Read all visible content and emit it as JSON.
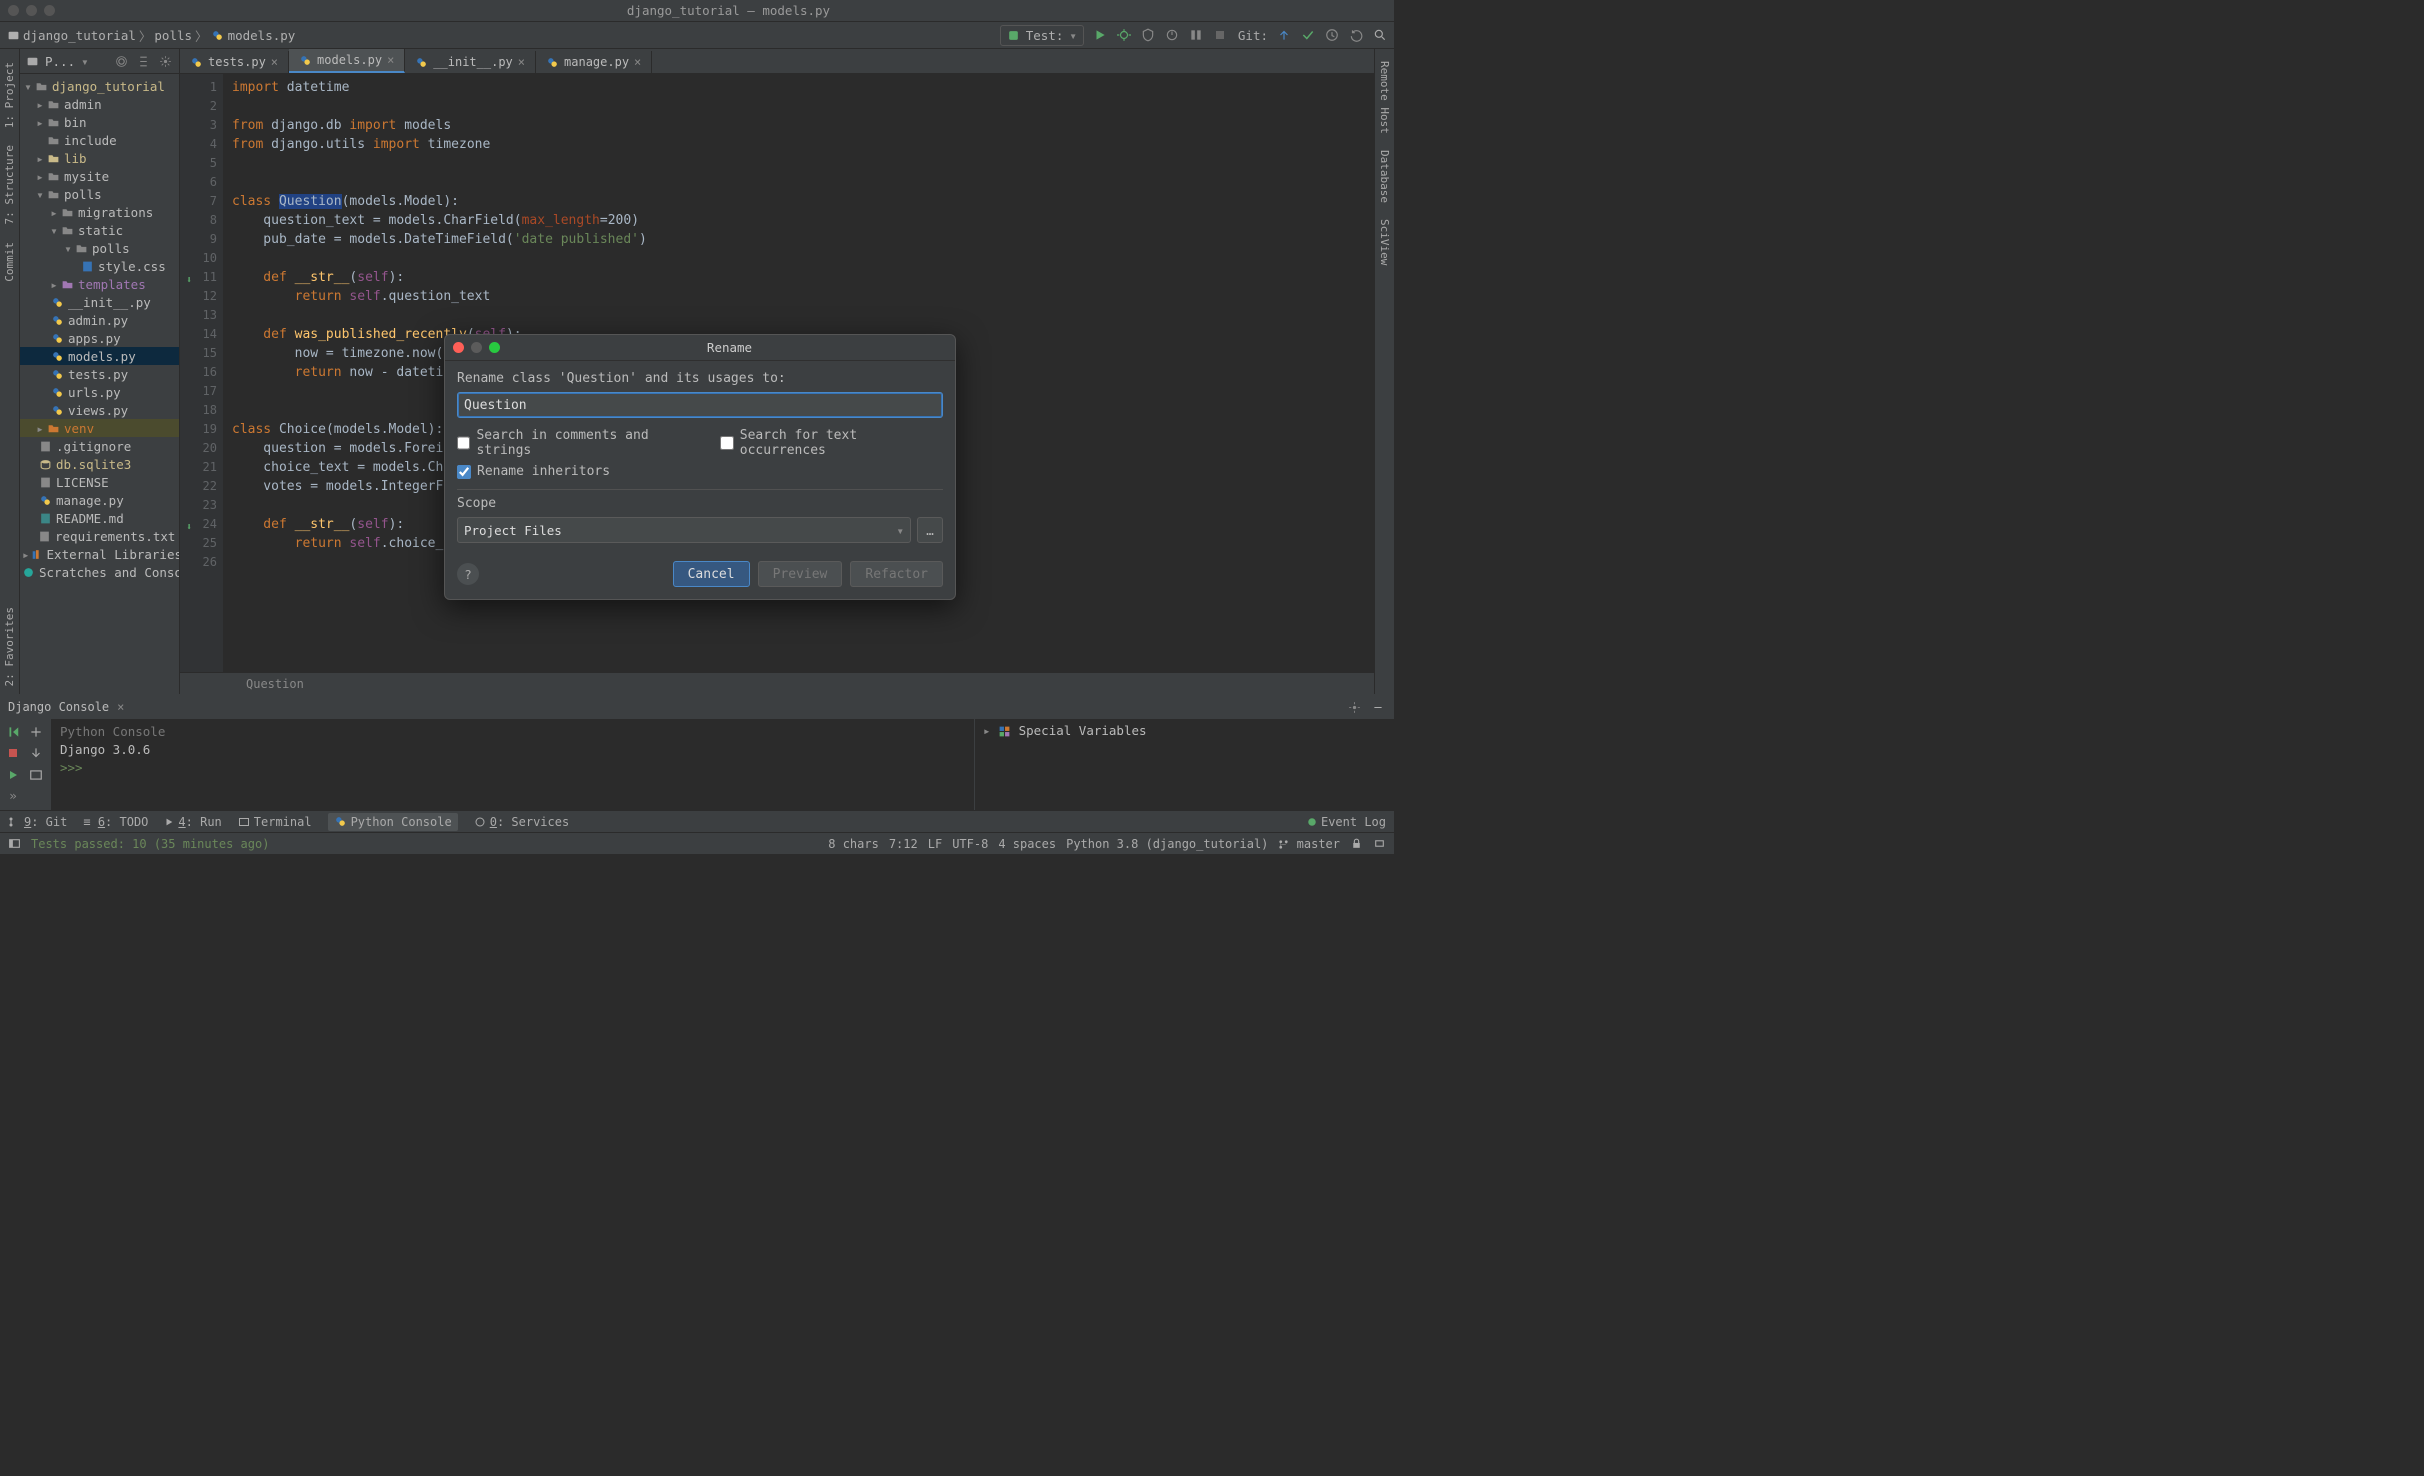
{
  "window_title": "django_tutorial – models.py",
  "breadcrumbs": {
    "p1": "django_tutorial",
    "p2": "polls",
    "p3": "models.py"
  },
  "run_config": "Test:",
  "git_label": "Git:",
  "left_tabs": {
    "project": "1: Project",
    "structure": "7: Structure",
    "commit": "Commit",
    "favorites": "2: Favorites"
  },
  "right_tabs": {
    "remote": "Remote Host",
    "database": "Database",
    "sciview": "SciView"
  },
  "project_header": "P...",
  "tree": {
    "root": "django_tutorial",
    "admin": "admin",
    "bin": "bin",
    "include": "include",
    "lib": "lib",
    "mysite": "mysite",
    "polls": "polls",
    "migrations": "migrations",
    "static": "static",
    "pollsdir": "polls",
    "stylecss": "style.css",
    "templates": "templates",
    "initpy": "__init__.py",
    "adminpy": "admin.py",
    "appspy": "apps.py",
    "modelspy": "models.py",
    "testspy": "tests.py",
    "urlspy": "urls.py",
    "viewspy": "views.py",
    "venv": "venv",
    "gitignore": ".gitignore",
    "dbsqlite": "db.sqlite3",
    "license": "LICENSE",
    "managepy": "manage.py",
    "readme": "README.md",
    "requirements": "requirements.txt",
    "extlib": "External Libraries",
    "scratches": "Scratches and Consoles"
  },
  "tabs": {
    "t1": "tests.py",
    "t2": "models.py",
    "t3": "__init__.py",
    "t4": "manage.py"
  },
  "code": {
    "l1a": "import",
    "l1b": " datetime",
    "l3a": "from",
    "l3b": " django.db ",
    "l3c": "import",
    "l3d": " models",
    "l4a": "from",
    "l4b": " django.utils ",
    "l4c": "import",
    "l4d": " timezone",
    "l7a": "class ",
    "l7b": "Question",
    "l7c": "(models.Model):",
    "l8": "    question_text = models.CharField(",
    "l8p": "max_length",
    "l8n": "=200",
    "l8e": ")",
    "l9a": "    pub_date = models.DateTimeField(",
    "l9s": "'date published'",
    "l9e": ")",
    "l11a": "    def ",
    "l11b": "__str__",
    "l11c": "(",
    "l11d": "self",
    "l11e": "):",
    "l12a": "        return ",
    "l12b": "self",
    "l12c": ".question_text",
    "l14a": "    def ",
    "l14b": "was_published_recently",
    "l14c": "(",
    "l14d": "self",
    "l14e": "):",
    "l15a": "        now = timezone.now()",
    "l16a": "        return ",
    "l16b": "now - datetime",
    "l19a": "class ",
    "l19b": "Choice",
    "l19c": "(models.Model):",
    "l20": "    question = models.ForeignKey",
    "l21": "    choice_text = models.CharField",
    "l22": "    votes = models.IntegerField",
    "l24a": "    def ",
    "l24b": "__str__",
    "l24c": "(",
    "l24d": "self",
    "l24e": "):",
    "l25a": "        return ",
    "l25b": "self",
    "l25c": ".choice_text"
  },
  "editor_crumb": "Question",
  "console": {
    "title": "Django Console",
    "line1": "Python Console",
    "line2": "Django 3.0.6",
    "prompt": ">>>",
    "vars": "Special Variables"
  },
  "tooltabs": {
    "git": "9: Git",
    "todo": "6: TODO",
    "run": "4: Run",
    "terminal": "Terminal",
    "pyconsole": "Python Console",
    "services": "0: Services",
    "eventlog": "Event Log"
  },
  "status": {
    "tests": "Tests passed: 10 (35 minutes ago)",
    "chars": "8 chars",
    "pos": "7:12",
    "lf": "LF",
    "enc": "UTF-8",
    "indent": "4 spaces",
    "interp": "Python 3.8 (django_tutorial)",
    "branch": "master"
  },
  "dialog": {
    "title": "Rename",
    "label": "Rename class 'Question' and its usages to:",
    "value": "Question",
    "chk1": "Search in comments and strings",
    "chk2": "Search for text occurrences",
    "chk3": "Rename inheritors",
    "scope_label": "Scope",
    "scope_value": "Project Files",
    "btn_cancel": "Cancel",
    "btn_preview": "Preview",
    "btn_refactor": "Refactor"
  }
}
